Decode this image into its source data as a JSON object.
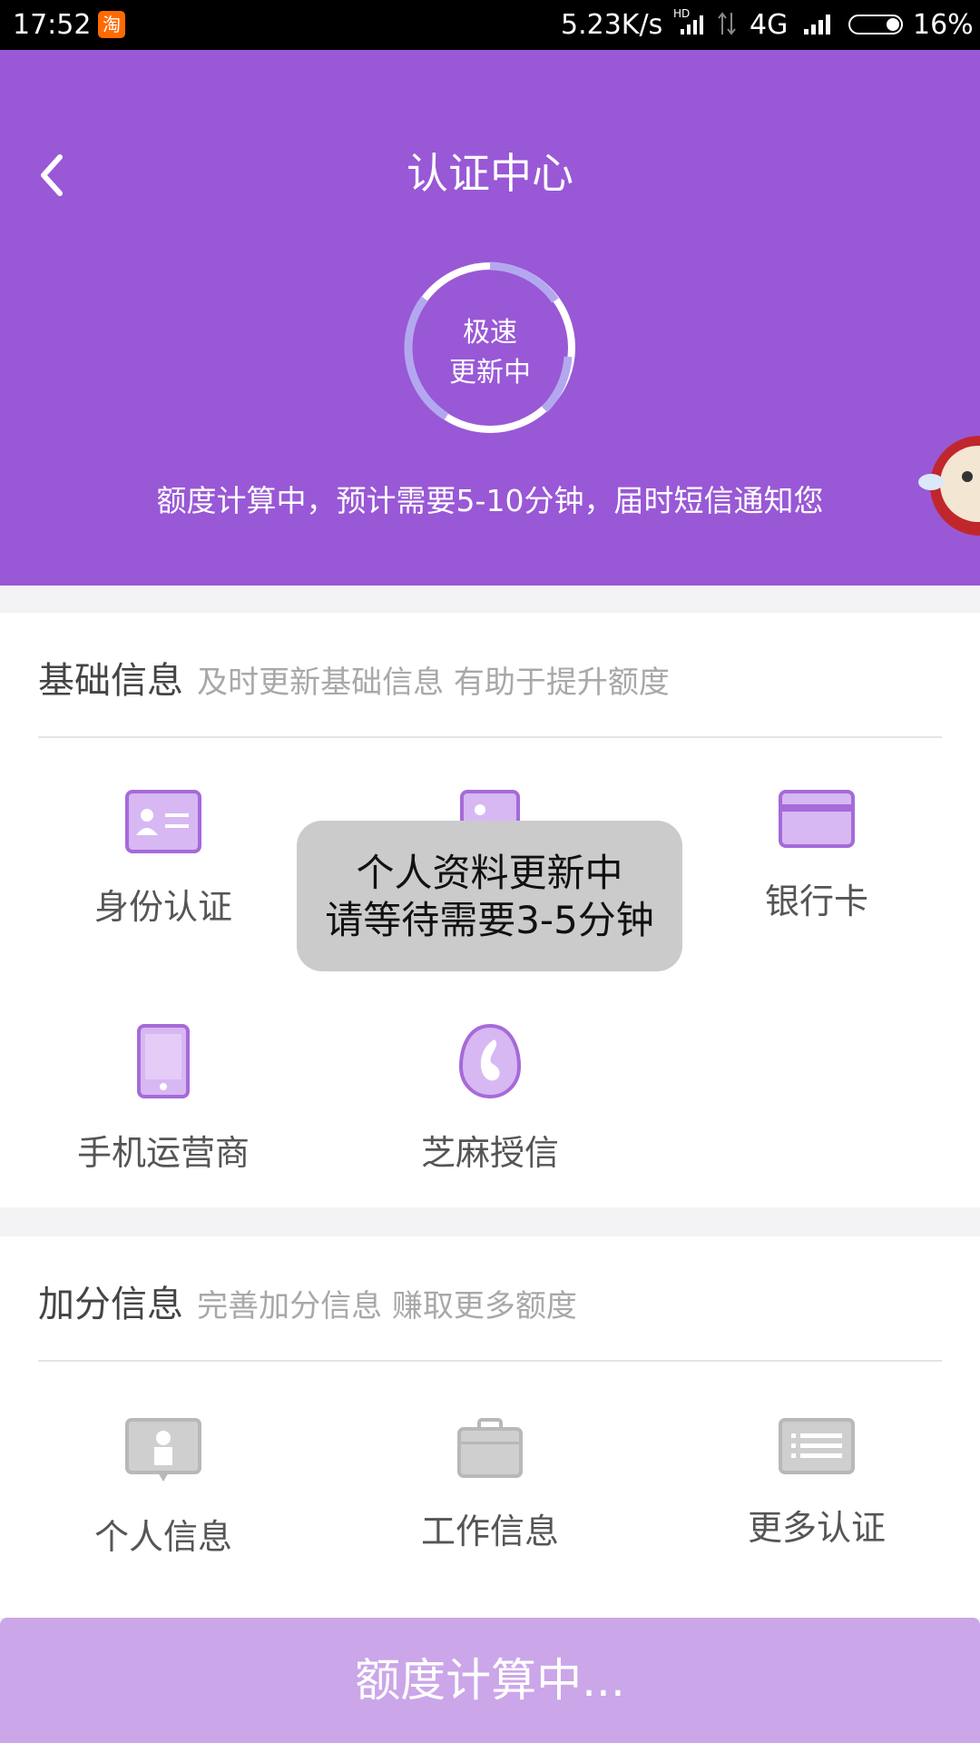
{
  "status_bar": {
    "time": "17:52",
    "app_badge": "淘",
    "network_speed": "5.23K/s",
    "hd": "HD",
    "network_type": "4G",
    "battery": "16%"
  },
  "header": {
    "title": "认证中心",
    "ring_line1": "极速",
    "ring_line2": "更新中",
    "note": "额度计算中，预计需要5-10分钟，届时短信通知您"
  },
  "basic_info": {
    "title": "基础信息",
    "subtitle": "及时更新基础信息 有助于提升额度",
    "items": [
      {
        "label": "身份认证",
        "icon": "id-card-icon"
      },
      {
        "label": "",
        "icon": "profile-card-icon"
      },
      {
        "label": "银行卡",
        "icon": "bank-card-icon"
      },
      {
        "label": "手机运营商",
        "icon": "phone-icon"
      },
      {
        "label": "芝麻授信",
        "icon": "sesame-credit-icon"
      }
    ]
  },
  "bonus_info": {
    "title": "加分信息",
    "subtitle": "完善加分信息 赚取更多额度",
    "items": [
      {
        "label": "个人信息",
        "icon": "personal-info-icon"
      },
      {
        "label": "工作信息",
        "icon": "briefcase-icon"
      },
      {
        "label": "更多认证",
        "icon": "list-icon"
      }
    ]
  },
  "toast": {
    "line1": "个人资料更新中",
    "line2": "请等待需要3-5分钟"
  },
  "bottom_button": {
    "label": "额度计算中..."
  },
  "colors": {
    "primary": "#9958d6",
    "icon_purple": "#a66ad9",
    "icon_gray": "#bdbdbd",
    "button_disabled": "#cba6e8"
  }
}
